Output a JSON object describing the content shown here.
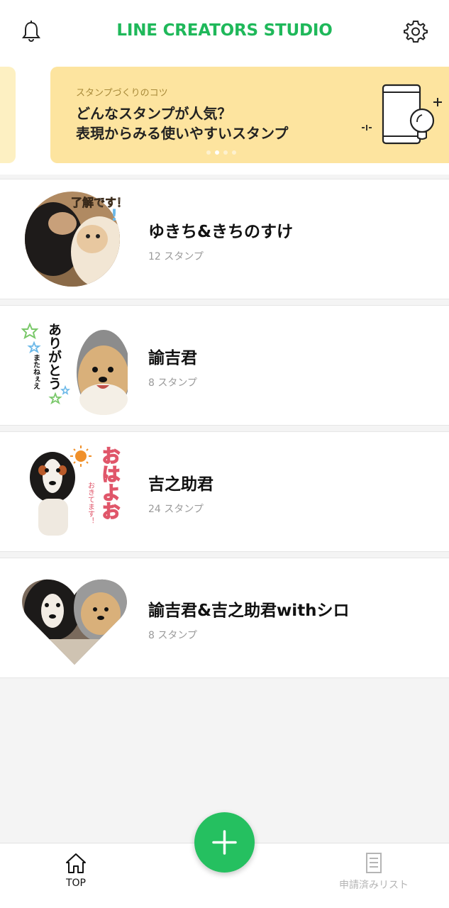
{
  "header": {
    "title": "LINE CREATORS STUDIO",
    "left_icon": "bell-icon",
    "right_icon": "gear-icon"
  },
  "banner": {
    "eyebrow": "スタンプづくりのコツ",
    "headline": "どんなスタンプが人気？\n表現からみる使いやすいスタンプ",
    "icon": "tablet-lightbulb-icon",
    "page_count": 4,
    "active_index": 1
  },
  "stickers": [
    {
      "name": "ゆきち&きちのすけ",
      "count": "12 スタンプ",
      "thumb": "circle-dogs-thumbnail",
      "thumb_text": "了解です！"
    },
    {
      "name": "諭吉君",
      "count": "8 スタンプ",
      "thumb": "arigatou-pomeranian-thumbnail",
      "thumb_text": "ありがとう",
      "thumb_subtext": "またねぇえ"
    },
    {
      "name": "吉之助君",
      "count": "24 スタンプ",
      "thumb": "ohayo-cavalier-thumbnail",
      "thumb_text": "おはよお",
      "thumb_subtext": "おきてます！"
    },
    {
      "name": "諭吉君&吉之助君withシロ",
      "count": "8 スタンプ",
      "thumb": "heart-dogs-thumbnail"
    }
  ],
  "fab": {
    "icon": "plus-icon"
  },
  "bottom_nav": {
    "items": [
      {
        "label": "TOP",
        "icon": "home-icon",
        "active": true
      },
      {
        "label": "申請済みリスト",
        "icon": "document-list-icon",
        "active": false
      }
    ]
  },
  "colors": {
    "brand_green": "#1fb85a",
    "fab_green": "#25c060",
    "banner_yellow": "#fde49f",
    "background": "#f4f4f4"
  }
}
